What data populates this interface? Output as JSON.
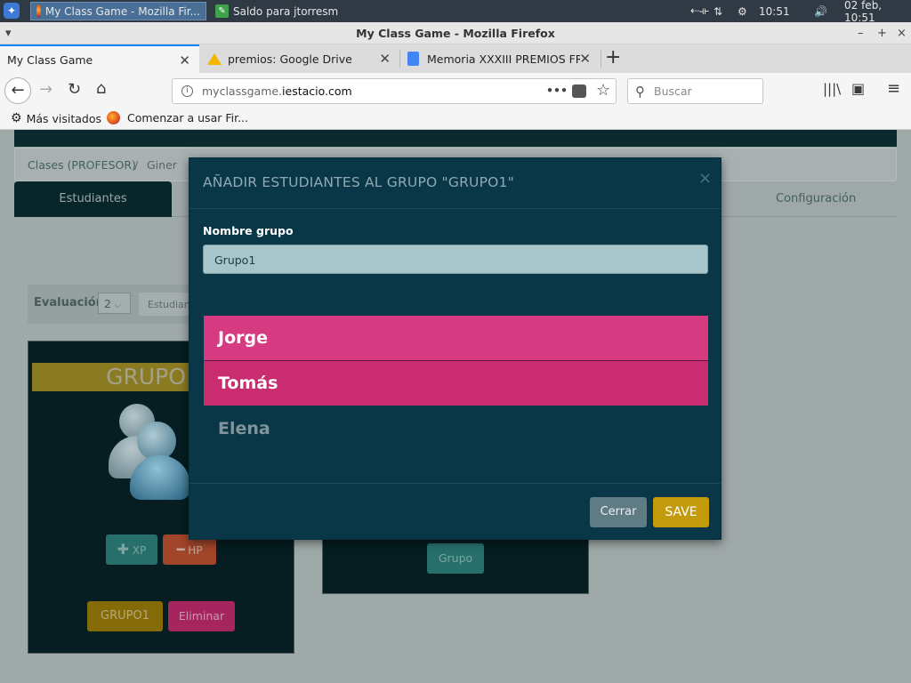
{
  "taskbar": {
    "tasks": [
      {
        "label": "My Class Game - Mozilla Fir..."
      },
      {
        "label": "Saldo para jtorresm"
      }
    ],
    "time": "10:51",
    "date": "02 feb, 10:51"
  },
  "window": {
    "title": "My Class Game - Mozilla Firefox"
  },
  "browser": {
    "tabs": [
      {
        "label": "My Class Game"
      },
      {
        "label": "premios: Google Drive"
      },
      {
        "label": "Memoria XXXIII PREMIOS FRA"
      }
    ],
    "url_prefix": "myclassgame.",
    "url_domain": "iestacio.com",
    "search_placeholder": "Buscar",
    "bookmarks": [
      {
        "label": "Más visitados"
      },
      {
        "label": "Comenzar a usar Fir..."
      }
    ]
  },
  "app": {
    "breadcrumb": {
      "first": "Clases (PROFESOR)",
      "sep": "/",
      "second": "Giner"
    },
    "tabs": {
      "students": "Estudiantes",
      "config": "Configuración"
    },
    "filter": {
      "label": "Evaluación",
      "value": "2",
      "students": "Estudian"
    },
    "group_card": {
      "title": "GRUPO",
      "xp_label": "XP",
      "hp_label": "HP",
      "group_button": "GRUPO1",
      "delete_button": "Eliminar"
    },
    "card2": {
      "group_button": "Grupo"
    }
  },
  "modal": {
    "title": "AÑADIR ESTUDIANTES AL GRUPO \"GRUPO1\"",
    "close": "×",
    "field_label": "Nombre grupo",
    "field_value": "Grupo1",
    "students": [
      {
        "name": "Jorge",
        "color": "#d63a81"
      },
      {
        "name": "Tomás",
        "color": "#c92d6f"
      },
      {
        "name": "Elena",
        "color": "#0a3747"
      }
    ],
    "cancel_button": "Cerrar",
    "save_button": "SAVE"
  },
  "colors": {
    "modal_bg": "#0a3747",
    "save": "#c29a0b",
    "pink": "#d63a81",
    "teal_button": "#2a7e7a",
    "orange_button": "#c6502e"
  }
}
